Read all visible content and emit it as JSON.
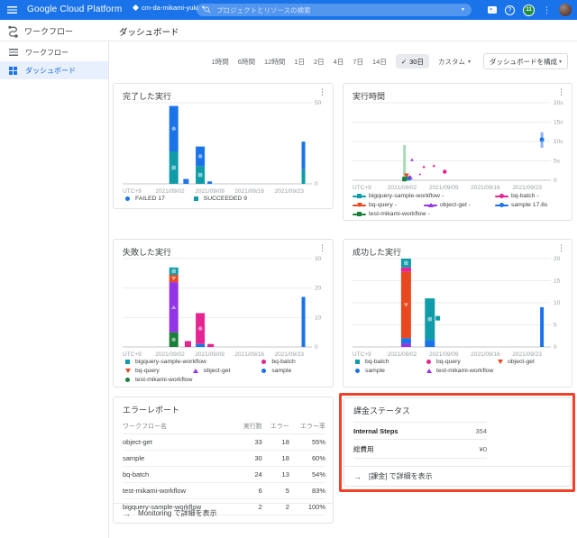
{
  "app_bar": {
    "product": "Google Cloud Platform",
    "project": "cm-da-mikami-yuki",
    "search_placeholder": "プロジェクトとリソースの検索",
    "notification_count": "11",
    "shell_glyph": ">_",
    "help_glyph": "?"
  },
  "product_bar": {
    "product_name": "ワークフロー",
    "page_title": "ダッシュボード"
  },
  "sidebar": {
    "items": [
      {
        "label": "ワークフロー"
      },
      {
        "label": "ダッシュボード"
      }
    ]
  },
  "toolbar": {
    "ranges": [
      "1時間",
      "6時間",
      "12時間",
      "1日",
      "2日",
      "4日",
      "7日",
      "14日"
    ],
    "selected_range": "30日",
    "custom": "カスタム",
    "configure": "ダッシュボードを構成"
  },
  "chart_data": [
    {
      "title": "完了した実行",
      "type": "bar",
      "stacked": true,
      "ylim": [
        0,
        50
      ],
      "yticks": [
        {
          "v": 0,
          "label": "0"
        },
        {
          "v": 50,
          "label": "50"
        }
      ],
      "xticks": [
        {
          "f": 0,
          "label": "UTC+9"
        },
        {
          "f": 0.25,
          "label": "2021/09/02"
        },
        {
          "f": 0.46,
          "label": "2021/09/09"
        },
        {
          "f": 0.67,
          "label": "2021/09/16"
        },
        {
          "f": 0.88,
          "label": "2021/09/23"
        }
      ],
      "series": [
        {
          "name": "FAILED",
          "legend": "FAILED 17",
          "color": "#1a73e8",
          "shape": "circle"
        },
        {
          "name": "SUCCEEDED",
          "legend": "SUCCEEDED 9",
          "color": "#0f9ba8",
          "shape": "square"
        }
      ],
      "bars": [
        {
          "f": 0.27,
          "w": 10,
          "stack": [
            [
              "SUCCEEDED",
              20
            ],
            [
              "FAILED",
              28
            ]
          ]
        },
        {
          "f": 0.335,
          "w": 6,
          "stack": [
            [
              "FAILED",
              3
            ]
          ]
        },
        {
          "f": 0.41,
          "w": 10,
          "stack": [
            [
              "SUCCEEDED",
              11
            ],
            [
              "FAILED",
              12
            ]
          ]
        },
        {
          "f": 0.46,
          "w": 5,
          "stack": [
            [
              "FAILED",
              1.5
            ]
          ]
        },
        {
          "f": 0.955,
          "w": 4,
          "stack": [
            [
              "SUCCEEDED",
              9
            ],
            [
              "FAILED",
              17
            ]
          ]
        }
      ]
    },
    {
      "title": "実行時間",
      "type": "scatter",
      "ylim": [
        0,
        20
      ],
      "yticks": [
        {
          "v": 0,
          "label": "0"
        },
        {
          "v": 5,
          "label": "5s"
        },
        {
          "v": 10,
          "label": "10s"
        },
        {
          "v": 15,
          "label": "15s"
        },
        {
          "v": 20,
          "label": "20s"
        }
      ],
      "xticks": [
        {
          "f": 0,
          "label": "UTC+9"
        },
        {
          "f": 0.25,
          "label": "2021/09/02"
        },
        {
          "f": 0.46,
          "label": "2021/09/09"
        },
        {
          "f": 0.67,
          "label": "2021/09/16"
        },
        {
          "f": 0.88,
          "label": "2021/09/23"
        }
      ],
      "legend_line": true,
      "series": [
        {
          "name": "bigquery-sample-workflow",
          "legend": "bigquery-sample-workflow -",
          "color": "#0f9ba8",
          "shape": "square"
        },
        {
          "name": "bq-batch",
          "legend": "bq-batch -",
          "color": "#e52592",
          "shape": "circle"
        },
        {
          "name": "bq-query",
          "legend": "bq-query -",
          "color": "#e8481f",
          "shape": "tri-down"
        },
        {
          "name": "object-get",
          "legend": "object-get -",
          "color": "#9334e6",
          "shape": "tri-up"
        },
        {
          "name": "sample",
          "legend": "sample 17.6s",
          "color": "#1a73e8",
          "shape": "circle"
        },
        {
          "name": "test-mikami-workflow",
          "legend": "test-mikami-workflow -",
          "color": "#188038",
          "shape": "square"
        }
      ],
      "ranges": [
        {
          "f": 0.262,
          "y1": 0.2,
          "y2": 9.1,
          "color": "#a8dab5"
        },
        {
          "f": 0.955,
          "y1": 8.4,
          "y2": 12.4,
          "color": "#8ab4f8"
        }
      ],
      "points": [
        {
          "f": 0.262,
          "y": 0.3,
          "series": "test-mikami-workflow",
          "s": 5
        },
        {
          "f": 0.283,
          "y": 0.5,
          "series": "bigquery-sample-workflow",
          "s": 5
        },
        {
          "f": 0.272,
          "y": 1.2,
          "series": "bq-query",
          "s": 5
        },
        {
          "f": 0.29,
          "y": 0.8,
          "series": "object-get",
          "s": 5
        },
        {
          "f": 0.3,
          "y": 5.3,
          "series": "object-get",
          "s": 3
        },
        {
          "f": 0.34,
          "y": 1.5,
          "series": "bq-batch",
          "s": 2
        },
        {
          "f": 0.36,
          "y": 3.4,
          "series": "bq-batch",
          "s": 2.5
        },
        {
          "f": 0.41,
          "y": 3.7,
          "series": "bq-batch",
          "s": 2.5
        },
        {
          "f": 0.465,
          "y": 2.2,
          "series": "bq-batch",
          "s": 4.5
        },
        {
          "f": 0.955,
          "y": 10.5,
          "series": "sample",
          "s": 5
        }
      ]
    },
    {
      "title": "失敗した実行",
      "type": "bar",
      "stacked": true,
      "ylim": [
        0,
        30
      ],
      "yticks": [
        {
          "v": 0,
          "label": "0"
        },
        {
          "v": 10,
          "label": "10"
        },
        {
          "v": 20,
          "label": "20"
        },
        {
          "v": 30,
          "label": "30"
        }
      ],
      "xticks": [
        {
          "f": 0,
          "label": "UTC+9"
        },
        {
          "f": 0.25,
          "label": "2021/09/02"
        },
        {
          "f": 0.46,
          "label": "2021/09/09"
        },
        {
          "f": 0.67,
          "label": "2021/09/16"
        },
        {
          "f": 0.88,
          "label": "2021/09/23"
        }
      ],
      "series": [
        {
          "name": "bigquery-sample-workflow",
          "legend": "bigquery-sample-workflow",
          "color": "#0f9ba8",
          "shape": "square"
        },
        {
          "name": "bq-batch",
          "legend": "bq-batch",
          "color": "#e52592",
          "shape": "circle"
        },
        {
          "name": "bq-query",
          "legend": "bq-query",
          "color": "#e8481f",
          "shape": "tri-down"
        },
        {
          "name": "object-get",
          "legend": "object-get",
          "color": "#9334e6",
          "shape": "tri-up"
        },
        {
          "name": "sample",
          "legend": "sample",
          "color": "#1a73e8",
          "shape": "circle"
        },
        {
          "name": "test-mikami-workflow",
          "legend": "test-mikami-workflow",
          "color": "#188038",
          "shape": "circle"
        }
      ],
      "bars": [
        {
          "f": 0.27,
          "w": 10,
          "stack": [
            [
              "test-mikami-workflow",
              5
            ],
            [
              "object-get",
              17
            ],
            [
              "bq-query",
              2.5
            ],
            [
              "bigquery-sample-workflow",
              2.5
            ]
          ]
        },
        {
          "f": 0.345,
          "w": 7,
          "stack": [
            [
              "bq-batch",
              2
            ]
          ]
        },
        {
          "f": 0.41,
          "w": 10,
          "stack": [
            [
              "sample",
              1
            ],
            [
              "bq-batch",
              10.5
            ]
          ]
        },
        {
          "f": 0.465,
          "w": 7,
          "stack": [
            [
              "bq-batch",
              1
            ]
          ]
        },
        {
          "f": 0.955,
          "w": 4,
          "stack": [
            [
              "sample",
              17
            ]
          ]
        }
      ]
    },
    {
      "title": "成功した実行",
      "type": "bar",
      "stacked": true,
      "ylim": [
        0,
        20
      ],
      "yticks": [
        {
          "v": 0,
          "label": "0"
        },
        {
          "v": 5,
          "label": "5"
        },
        {
          "v": 10,
          "label": "10"
        },
        {
          "v": 15,
          "label": "15"
        },
        {
          "v": 20,
          "label": "20"
        }
      ],
      "xticks": [
        {
          "f": 0,
          "label": "UTC+9"
        },
        {
          "f": 0.25,
          "label": "2021/09/02"
        },
        {
          "f": 0.46,
          "label": "2021/09/09"
        },
        {
          "f": 0.67,
          "label": "2021/09/16"
        },
        {
          "f": 0.88,
          "label": "2021/09/23"
        }
      ],
      "series": [
        {
          "name": "bq-batch",
          "legend": "bq-batch",
          "color": "#0f9ba8",
          "shape": "square"
        },
        {
          "name": "bq-query",
          "legend": "bq-query",
          "color": "#e52592",
          "shape": "circle"
        },
        {
          "name": "object-get",
          "legend": "object-get",
          "color": "#e8481f",
          "shape": "tri-down"
        },
        {
          "name": "sample",
          "legend": "sample",
          "color": "#1a73e8",
          "shape": "circle"
        },
        {
          "name": "test-mikami-workflow",
          "legend": "test-mikami-workflow",
          "color": "#9334e6",
          "shape": "tri-up"
        }
      ],
      "bars": [
        {
          "f": 0.27,
          "w": 11,
          "stack": [
            [
              "test-mikami-workflow",
              0.8
            ],
            [
              "sample",
              1.2
            ],
            [
              "object-get",
              15
            ],
            [
              "bq-query",
              1
            ],
            [
              "bq-batch",
              2
            ]
          ]
        },
        {
          "f": 0.39,
          "w": 11,
          "stack": [
            [
              "sample",
              1.6
            ],
            [
              "bq-batch",
              9.4
            ]
          ]
        },
        {
          "f": 0.955,
          "w": 4,
          "stack": [
            [
              "sample",
              9
            ]
          ]
        }
      ],
      "points": [
        {
          "f": 0.43,
          "y": 6.5,
          "series": "bq-batch",
          "s": 5
        }
      ]
    }
  ],
  "error_report": {
    "title": "エラーレポート",
    "columns": [
      "ワークフロー名",
      "実行数",
      "エラー",
      "エラー率"
    ],
    "rows": [
      [
        "object-get",
        "33",
        "18",
        "55%"
      ],
      [
        "sample",
        "30",
        "18",
        "60%"
      ],
      [
        "bq-batch",
        "24",
        "13",
        "54%"
      ],
      [
        "test-mikami-workflow",
        "6",
        "5",
        "83%"
      ],
      [
        "bigquery-sample-workflow",
        "2",
        "2",
        "100%"
      ]
    ],
    "footer": "Monitoring で詳細を表示"
  },
  "billing": {
    "title": "課金ステータス",
    "rows": [
      {
        "label": "Internal Steps",
        "value": "354"
      },
      {
        "label": "総費用",
        "value": "¥0"
      }
    ],
    "footer": "[課金] で詳細を表示",
    "highlight_color": "#f2402a"
  }
}
